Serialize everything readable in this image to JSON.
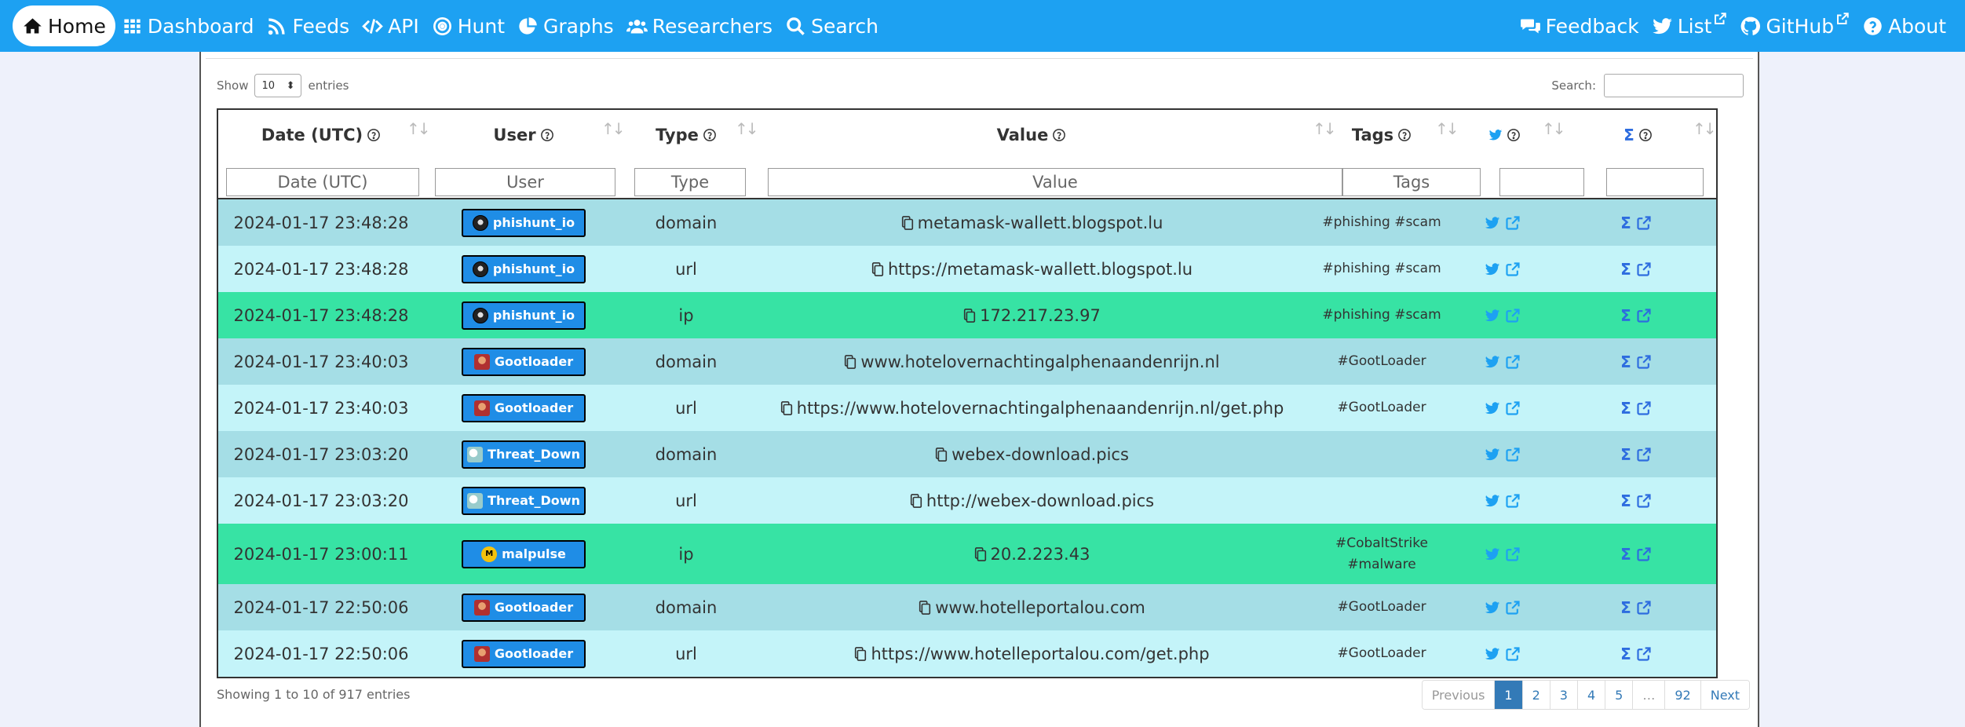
{
  "nav": {
    "left": [
      {
        "label": "Home",
        "icon": "home-icon",
        "active": true
      },
      {
        "label": "Dashboard",
        "icon": "grid-icon"
      },
      {
        "label": "Feeds",
        "icon": "rss-icon"
      },
      {
        "label": "API",
        "icon": "code-icon"
      },
      {
        "label": "Hunt",
        "icon": "target-icon"
      },
      {
        "label": "Graphs",
        "icon": "pie-chart-icon"
      },
      {
        "label": "Researchers",
        "icon": "users-icon"
      },
      {
        "label": "Search",
        "icon": "search-icon"
      }
    ],
    "right": [
      {
        "label": "Feedback",
        "icon": "comments-icon"
      },
      {
        "label": "List",
        "icon": "twitter-icon",
        "external": true
      },
      {
        "label": "GitHub",
        "icon": "github-icon",
        "external": true
      },
      {
        "label": "About",
        "icon": "question-circle-icon"
      }
    ]
  },
  "controls": {
    "show_label": "Show",
    "entries_value": "10",
    "entries_label": "entries",
    "search_label": "Search:"
  },
  "table": {
    "headers": {
      "date": "Date (UTC)",
      "user": "User",
      "type": "Type",
      "value": "Value",
      "tags": "Tags"
    },
    "filters": {
      "date": "Date (UTC)",
      "user": "User",
      "type": "Type",
      "value": "Value",
      "tags": "Tags"
    },
    "rows": [
      {
        "date": "2024-01-17 23:48:28",
        "user": "phishunt_io",
        "avatar": "phish",
        "type": "domain",
        "value": "metamask-wallett.blogspot.lu",
        "tags": "#phishing #scam",
        "color": "teal"
      },
      {
        "date": "2024-01-17 23:48:28",
        "user": "phishunt_io",
        "avatar": "phish",
        "type": "url",
        "value": "https://metamask-wallett.blogspot.lu",
        "tags": "#phishing #scam",
        "color": "light"
      },
      {
        "date": "2024-01-17 23:48:28",
        "user": "phishunt_io",
        "avatar": "phish",
        "type": "ip",
        "value": "172.217.23.97",
        "tags": "#phishing #scam",
        "color": "green"
      },
      {
        "date": "2024-01-17 23:40:03",
        "user": "Gootloader",
        "avatar": "goot",
        "type": "domain",
        "value": "www.hotelovernachtingalphenaandenrijn.nl",
        "tags": "#GootLoader",
        "color": "teal"
      },
      {
        "date": "2024-01-17 23:40:03",
        "user": "Gootloader",
        "avatar": "goot",
        "type": "url",
        "value": "https://www.hotelovernachtingalphenaandenrijn.nl/get.php",
        "tags": "#GootLoader",
        "color": "light"
      },
      {
        "date": "2024-01-17 23:03:20",
        "user": "Threat_Down",
        "avatar": "threat",
        "type": "domain",
        "value": "webex-download.pics",
        "tags": "",
        "color": "teal"
      },
      {
        "date": "2024-01-17 23:03:20",
        "user": "Threat_Down",
        "avatar": "threat",
        "type": "url",
        "value": "http://webex-download.pics",
        "tags": "",
        "color": "light"
      },
      {
        "date": "2024-01-17 23:00:11",
        "user": "malpulse",
        "avatar": "mal",
        "type": "ip",
        "value": "20.2.223.43",
        "tags": "#CobaltStrike #malware",
        "tags_lines": [
          "#CobaltStrike",
          "#malware"
        ],
        "color": "green",
        "tall": true
      },
      {
        "date": "2024-01-17 22:50:06",
        "user": "Gootloader",
        "avatar": "goot",
        "type": "domain",
        "value": "www.hotelleportalou.com",
        "tags": "#GootLoader",
        "color": "teal"
      },
      {
        "date": "2024-01-17 22:50:06",
        "user": "Gootloader",
        "avatar": "goot",
        "type": "url",
        "value": "https://www.hotelleportalou.com/get.php",
        "tags": "#GootLoader",
        "color": "light"
      }
    ]
  },
  "footer": {
    "info": "Showing 1 to 10 of 917 entries",
    "pages": [
      "Previous",
      "1",
      "2",
      "3",
      "4",
      "5",
      "…",
      "92",
      "Next"
    ],
    "active_page": "1"
  },
  "colors": {
    "navbar": "#1da1f2",
    "row_teal": "#a5dee6",
    "row_light": "#c4f4f9",
    "row_green": "#37e3a4",
    "user_badge": "#1f8de6"
  }
}
